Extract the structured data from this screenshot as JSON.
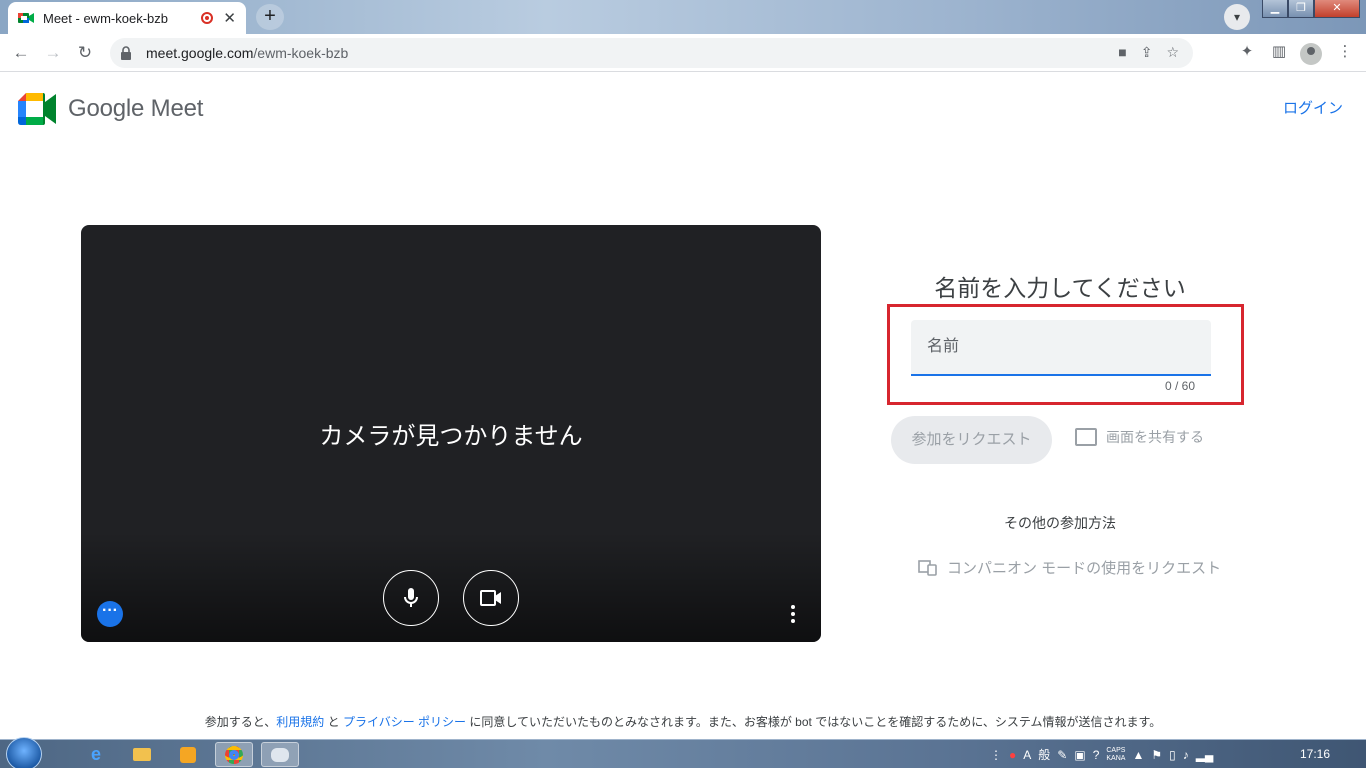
{
  "browser": {
    "tab_title": "Meet - ewm-koek-bzb",
    "tab_close": "✕",
    "new_tab": "+",
    "url_host": "meet.google.com",
    "url_path": "/ewm-koek-bzb"
  },
  "header": {
    "brand": "Google Meet",
    "login": "ログイン"
  },
  "preview": {
    "message": "カメラが見つかりません"
  },
  "join": {
    "heading": "名前を入力してください",
    "name_placeholder": "名前",
    "counter": "0 / 60",
    "request_button": "参加をリクエスト",
    "share_screen": "画面を共有する",
    "other_methods": "その他の参加方法",
    "companion_mode": "コンパニオン モードの使用をリクエスト"
  },
  "footer": {
    "prefix": "参加すると、",
    "terms": "利用規約",
    "and": "と",
    "privacy": "プライバシー ポリシー",
    "suffix": "に同意していただいたものとみなされます。また、お客様が bot ではないことを確認するために、システム情報が送信されます。"
  },
  "taskbar": {
    "ime_mode": "A",
    "ime_kanji": "般",
    "caps": "CAPS",
    "kana": "KANA",
    "time": "17:16"
  },
  "colors": {
    "accent": "#1a73e8",
    "highlight_box": "#d7262f",
    "preview_bg": "#202124"
  }
}
